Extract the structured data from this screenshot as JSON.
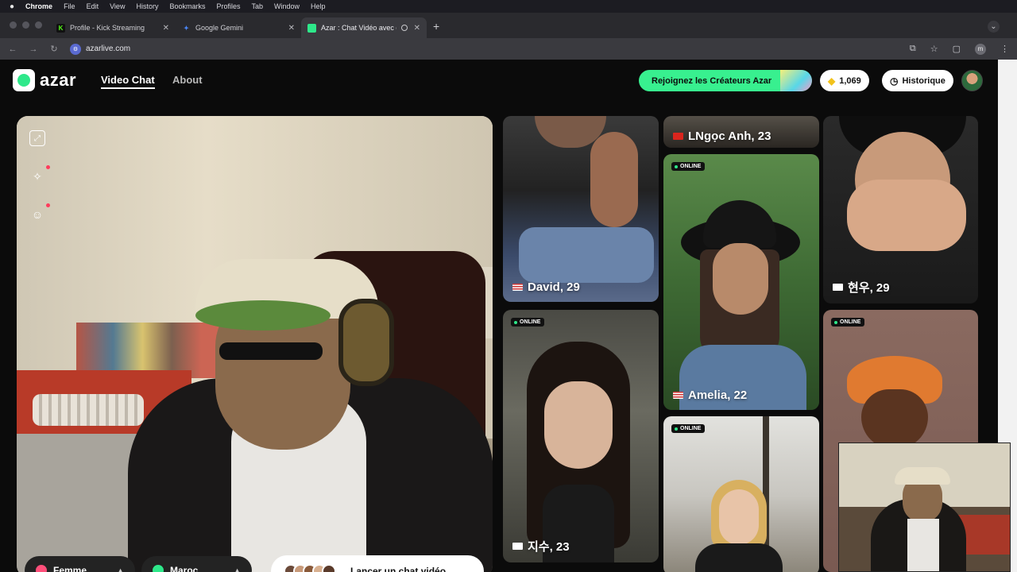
{
  "os_menu": {
    "apple": "",
    "items": [
      "Chrome",
      "File",
      "Edit",
      "View",
      "History",
      "Bookmarks",
      "Profiles",
      "Tab",
      "Window",
      "Help"
    ]
  },
  "browser": {
    "tabs": [
      {
        "title": "Profile - Kick Streaming",
        "favicon": "K",
        "favicon_color": "#53fc18",
        "active": false
      },
      {
        "title": "Google Gemini",
        "favicon": "✦",
        "favicon_color": "#4a86f7",
        "active": false
      },
      {
        "title": "Azar : Chat Vidéo avec de",
        "favicon": "",
        "favicon_color": "#2ee88a",
        "active": true
      }
    ],
    "new_tab": "+",
    "url": "azarlive.com",
    "profile_initial": "m"
  },
  "site": {
    "logo_text": "azar",
    "nav": [
      {
        "label": "Video Chat",
        "active": true
      },
      {
        "label": "About",
        "active": false
      }
    ],
    "creators_button": "Rejoignez les Créateurs Azar",
    "gems": "1,069",
    "history_label": "Historique",
    "accent": "#38f08f"
  },
  "controls": {
    "gender_label": "Femme",
    "region_label": "Maroc",
    "launch_label": "Lancer un chat vidéo"
  },
  "online_label": "ONLINE",
  "cards": [
    {
      "name": "David, 29",
      "flag": "us",
      "online": false
    },
    {
      "name": "LNgọc Anh, 23",
      "flag": "vn",
      "online": false
    },
    {
      "name": "현우, 29",
      "flag": "kr",
      "online": false
    },
    {
      "name": "Amelia, 22",
      "flag": "us",
      "online": true
    },
    {
      "name": "지수, 23",
      "flag": "kr",
      "online": true
    },
    {
      "name": "",
      "flag": "",
      "online": true
    },
    {
      "name": "",
      "flag": "",
      "online": true
    }
  ]
}
